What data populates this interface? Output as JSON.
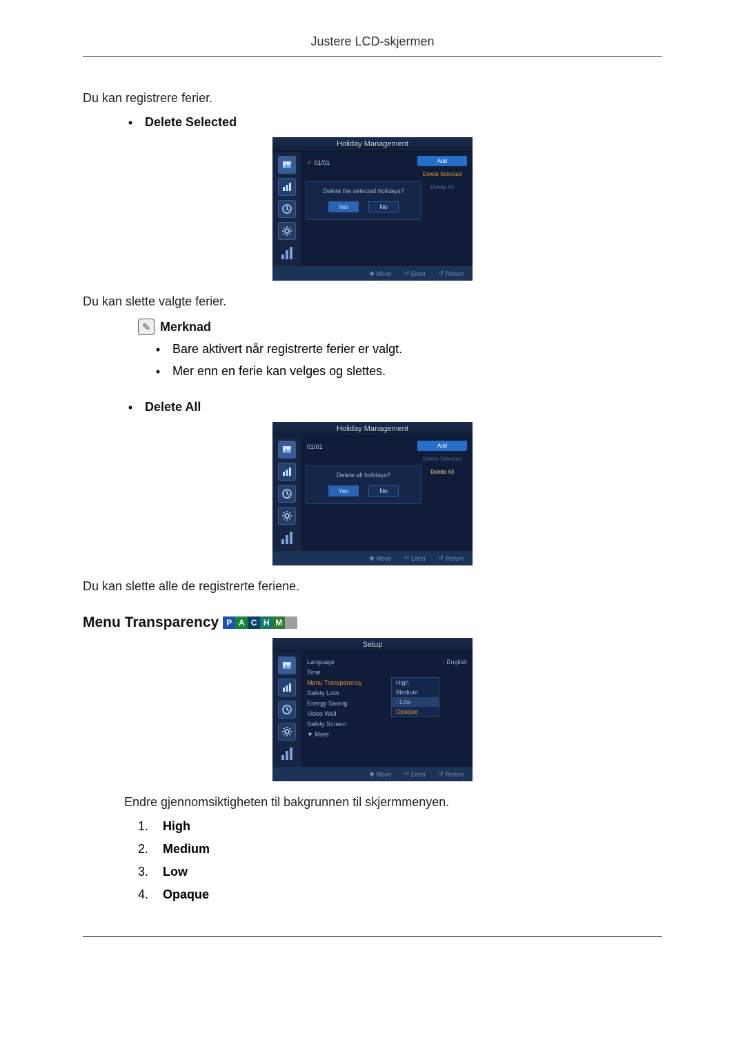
{
  "header": {
    "title": "Justere LCD-skjermen"
  },
  "intro": "Du kan registrere ferier.",
  "deleteSelected": {
    "heading": "Delete Selected",
    "osd": {
      "title": "Holiday Management",
      "date": "01/01",
      "dialogQuestion": "Delete the selected holidays?",
      "yes": "Yes",
      "no": "No",
      "actions": {
        "add": "Add",
        "deleteSelected": "Delete Selected",
        "deleteAll": "Delete All"
      },
      "footer": {
        "move": "Move",
        "enter": "Enter",
        "return": "Return"
      }
    },
    "afterText": "Du kan slette valgte ferier.",
    "noteLabel": "Merknad",
    "noteBullets": [
      "Bare aktivert når registrerte ferier er valgt.",
      "Mer enn en ferie kan velges og slettes."
    ]
  },
  "deleteAll": {
    "heading": "Delete All",
    "osd": {
      "title": "Holiday Management",
      "date": "01/01",
      "dialogQuestion": "Delete all holidays?",
      "yes": "Yes",
      "no": "No",
      "actions": {
        "add": "Add",
        "deleteSelected": "Delete Selected",
        "deleteAll": "Delete All"
      },
      "footer": {
        "move": "Move",
        "enter": "Enter",
        "return": "Return"
      }
    },
    "afterText": "Du kan slette alle de registrerte feriene."
  },
  "menuTransparency": {
    "heading": "Menu Transparency",
    "tags": [
      "P",
      "A",
      "C",
      "H",
      "M",
      ""
    ],
    "osd": {
      "title": "Setup",
      "rows": [
        {
          "label": "Language",
          "value": ": English"
        },
        {
          "label": "Time",
          "value": ""
        },
        {
          "label": "Menu Transparency",
          "value": "",
          "hl": true
        },
        {
          "label": "Safety Lock",
          "value": ""
        },
        {
          "label": "Energy Saving",
          "value": ""
        },
        {
          "label": "Video Wall",
          "value": ""
        },
        {
          "label": "Safety Screen",
          "value": ""
        },
        {
          "label": "▼ More",
          "value": ""
        }
      ],
      "options": [
        "High",
        "Medium",
        "Low",
        "Opaque"
      ],
      "optionPrefix": ": ",
      "footer": {
        "move": "Move",
        "enter": "Enter",
        "return": "Return"
      }
    },
    "afterText": "Endre gjennomsiktigheten til bakgrunnen til skjermmenyen.",
    "list": [
      {
        "n": "1.",
        "label": "High"
      },
      {
        "n": "2.",
        "label": "Medium"
      },
      {
        "n": "3.",
        "label": "Low"
      },
      {
        "n": "4.",
        "label": "Opaque"
      }
    ]
  }
}
